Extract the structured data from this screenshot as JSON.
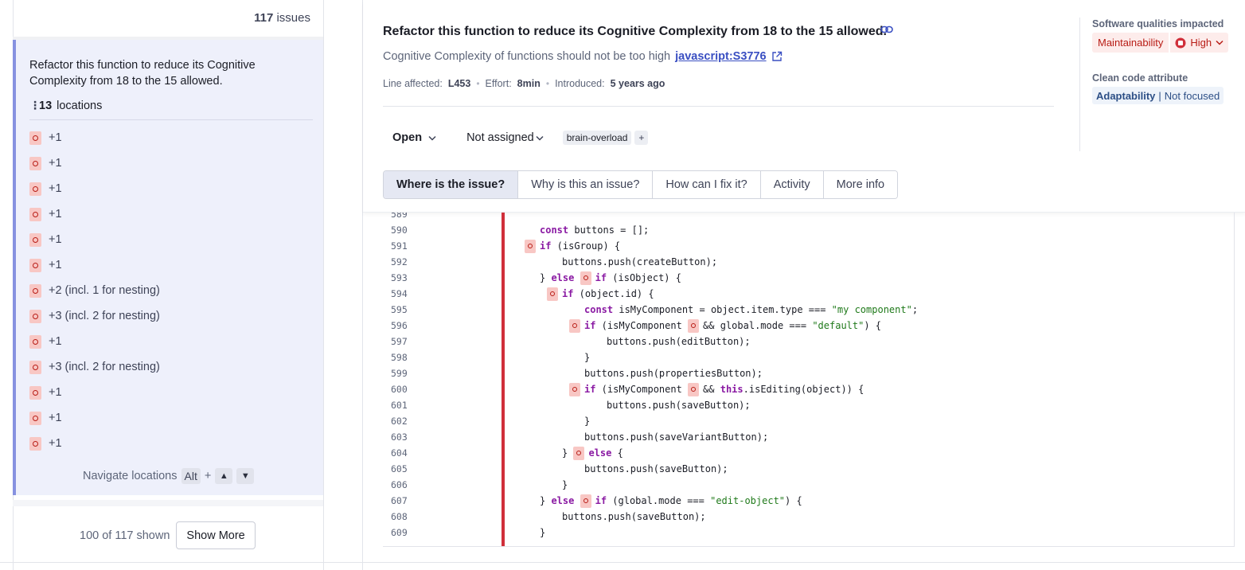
{
  "issue_list": {
    "count": "117",
    "count_label": "issues",
    "selected_issue": {
      "title": "Refactor this function to reduce its Cognitive Complexity from 18 to the 15 allowed.",
      "locations_count": "13",
      "locations_label": "locations",
      "locations": [
        "+1",
        "+1",
        "+1",
        "+1",
        "+1",
        "+1",
        "+2 (incl. 1 for nesting)",
        "+3 (incl. 2 for nesting)",
        "+1",
        "+3 (incl. 2 for nesting)",
        "+1",
        "+1",
        "+1"
      ],
      "navigate_label": "Navigate locations",
      "navigate_key": "Alt",
      "navigate_plus": "+",
      "nav_up": "▲",
      "nav_down": "▼"
    },
    "shown_text": "100 of 117 shown",
    "show_more_label": "Show More"
  },
  "issue": {
    "title": "Refactor this function to reduce its Cognitive Complexity from 18 to the 15 allowed.",
    "rule_text": "Cognitive Complexity of functions should not be too high",
    "rule_key": "javascript:S3776",
    "line_affected_label": "Line affected:",
    "line_affected": "L453",
    "effort_label": "Effort:",
    "effort": "8min",
    "introduced_label": "Introduced:",
    "introduced": "5 years ago",
    "status": "Open",
    "assignee": "Not assigned",
    "tag": "brain-overload",
    "tag_add": "+"
  },
  "tabs": [
    {
      "label": "Where is the issue?",
      "active": true
    },
    {
      "label": "Why is this an issue?",
      "active": false
    },
    {
      "label": "How can I fix it?",
      "active": false
    },
    {
      "label": "Activity",
      "active": false
    },
    {
      "label": "More info",
      "active": false
    }
  ],
  "side": {
    "software_qualities_label": "Software qualities impacted",
    "quality": "Maintainability",
    "severity": "High",
    "clean_code_label": "Clean code attribute",
    "attribute": "Adaptability",
    "attribute_separator": "|",
    "attribute_detail": "Not focused"
  },
  "code": {
    "lines": [
      {
        "n": "589",
        "indent": 0,
        "parts": []
      },
      {
        "n": "590",
        "indent": 3,
        "parts": [
          [
            "kw",
            "const"
          ],
          [
            "t",
            " buttons = [];"
          ]
        ]
      },
      {
        "n": "591",
        "indent": 3,
        "parts": [
          [
            "m",
            ""
          ],
          [
            "kw",
            "if"
          ],
          [
            "t",
            " (isGroup) {"
          ]
        ]
      },
      {
        "n": "592",
        "indent": 4,
        "parts": [
          [
            "t",
            "buttons.push(createButton);"
          ]
        ]
      },
      {
        "n": "593",
        "indent": 3,
        "parts": [
          [
            "t",
            "} "
          ],
          [
            "kw",
            "else"
          ],
          [
            "t",
            " "
          ],
          [
            "m",
            ""
          ],
          [
            "kw",
            "if"
          ],
          [
            "t",
            " (isObject) {"
          ]
        ]
      },
      {
        "n": "594",
        "indent": 4,
        "parts": [
          [
            "m",
            ""
          ],
          [
            "kw",
            "if"
          ],
          [
            "t",
            " (object.id) {"
          ]
        ]
      },
      {
        "n": "595",
        "indent": 5,
        "parts": [
          [
            "kw",
            "const"
          ],
          [
            "t",
            " isMyComponent = object.item.type === "
          ],
          [
            "str",
            "\"my component\""
          ],
          [
            "t",
            ";"
          ]
        ]
      },
      {
        "n": "596",
        "indent": 5,
        "parts": [
          [
            "m",
            ""
          ],
          [
            "kw",
            "if"
          ],
          [
            "t",
            " (isMyComponent "
          ],
          [
            "m",
            ""
          ],
          [
            "t",
            "&& global.mode === "
          ],
          [
            "str",
            "\"default\""
          ],
          [
            "t",
            ") {"
          ]
        ]
      },
      {
        "n": "597",
        "indent": 6,
        "parts": [
          [
            "t",
            "buttons.push(editButton);"
          ]
        ]
      },
      {
        "n": "598",
        "indent": 5,
        "parts": [
          [
            "t",
            "}"
          ]
        ]
      },
      {
        "n": "599",
        "indent": 5,
        "parts": [
          [
            "t",
            "buttons.push(propertiesButton);"
          ]
        ]
      },
      {
        "n": "600",
        "indent": 5,
        "parts": [
          [
            "m",
            ""
          ],
          [
            "kw",
            "if"
          ],
          [
            "t",
            " (isMyComponent "
          ],
          [
            "m",
            ""
          ],
          [
            "t",
            "&& "
          ],
          [
            "kw",
            "this"
          ],
          [
            "t",
            ".isEditing(object)) {"
          ]
        ]
      },
      {
        "n": "601",
        "indent": 6,
        "parts": [
          [
            "t",
            "buttons.push(saveButton);"
          ]
        ]
      },
      {
        "n": "602",
        "indent": 5,
        "parts": [
          [
            "t",
            "}"
          ]
        ]
      },
      {
        "n": "603",
        "indent": 5,
        "parts": [
          [
            "t",
            "buttons.push(saveVariantButton);"
          ]
        ]
      },
      {
        "n": "604",
        "indent": 4,
        "parts": [
          [
            "t",
            "} "
          ],
          [
            "m",
            ""
          ],
          [
            "kw",
            "else"
          ],
          [
            "t",
            " {"
          ]
        ]
      },
      {
        "n": "605",
        "indent": 5,
        "parts": [
          [
            "t",
            "buttons.push(saveButton);"
          ]
        ]
      },
      {
        "n": "606",
        "indent": 4,
        "parts": [
          [
            "t",
            "}"
          ]
        ]
      },
      {
        "n": "607",
        "indent": 3,
        "parts": [
          [
            "t",
            "} "
          ],
          [
            "kw",
            "else"
          ],
          [
            "t",
            " "
          ],
          [
            "m",
            ""
          ],
          [
            "kw",
            "if"
          ],
          [
            "t",
            " (global.mode === "
          ],
          [
            "str",
            "\"edit-object\""
          ],
          [
            "t",
            ") {"
          ]
        ]
      },
      {
        "n": "608",
        "indent": 4,
        "parts": [
          [
            "t",
            "buttons.push(saveButton);"
          ]
        ]
      },
      {
        "n": "609",
        "indent": 3,
        "parts": [
          [
            "t",
            "}"
          ]
        ]
      }
    ]
  },
  "colors": {
    "accent": "#8691e0",
    "danger": "#b81c15",
    "link": "#3a4fc2",
    "keyword": "#8a1aa3",
    "string": "#207a1b"
  }
}
